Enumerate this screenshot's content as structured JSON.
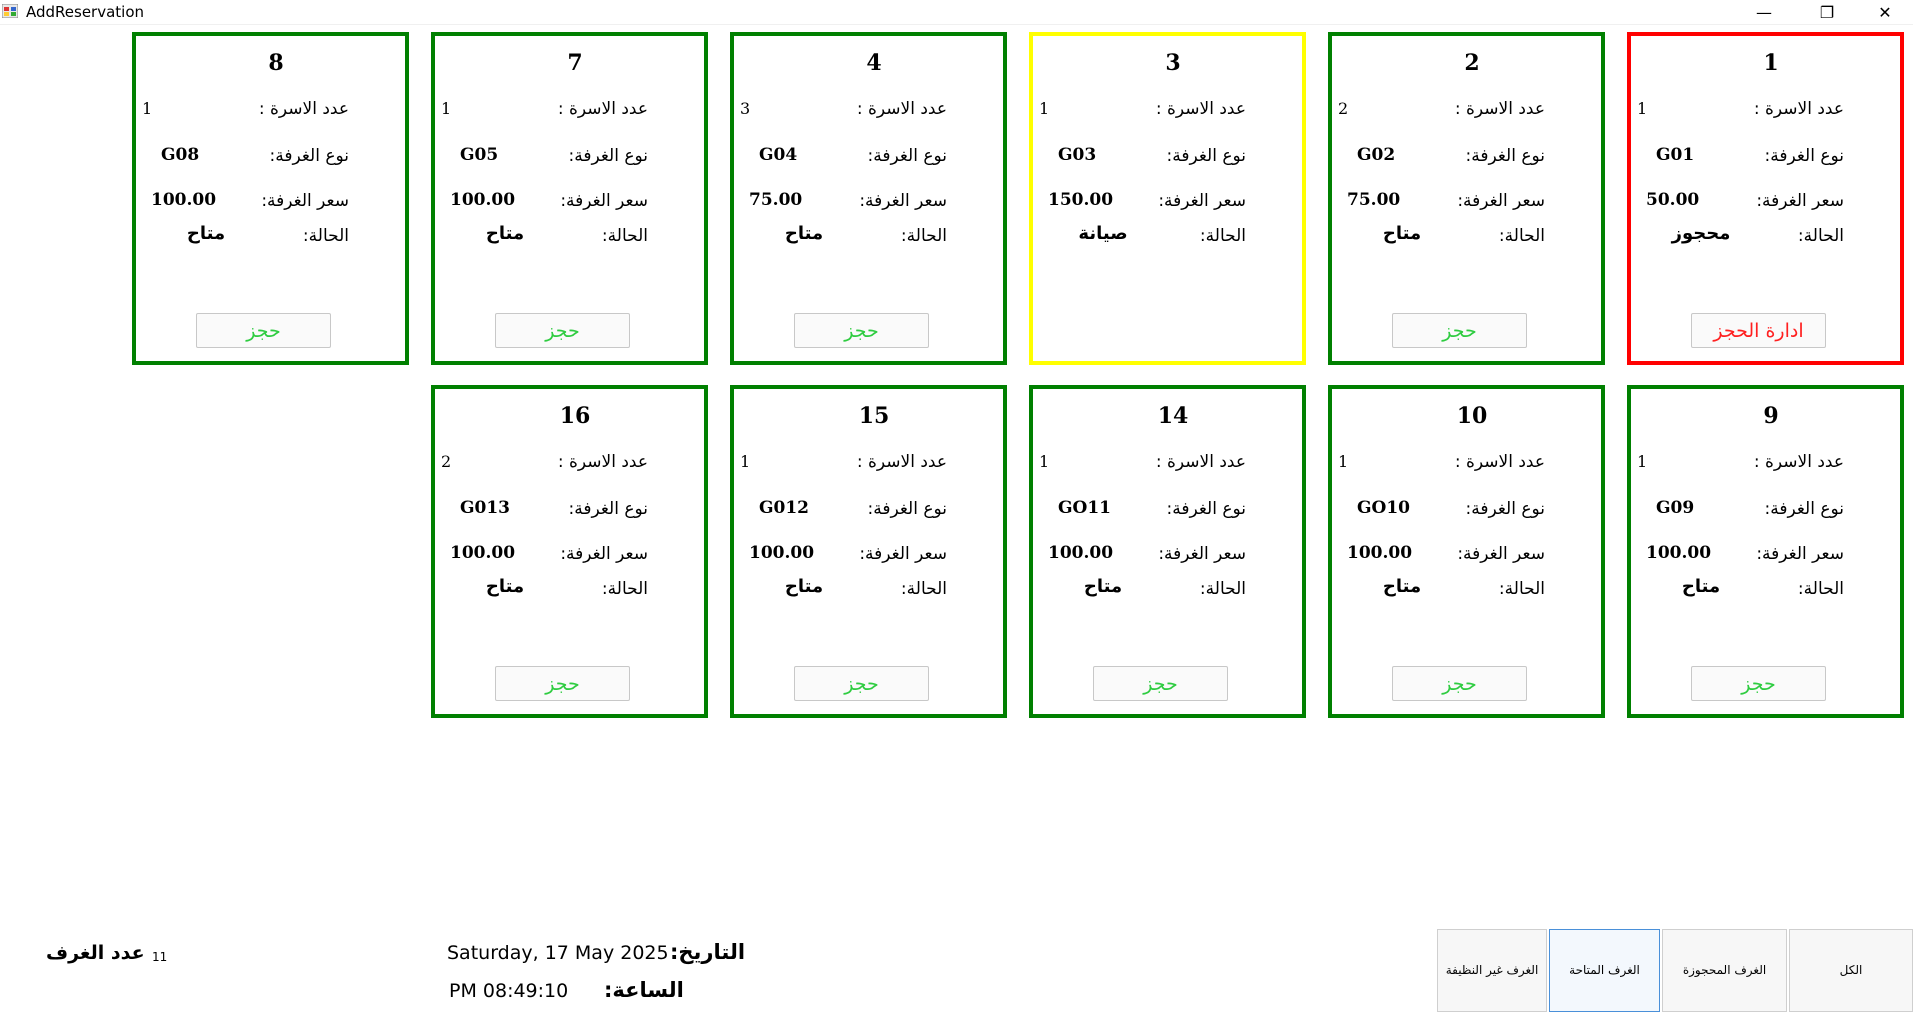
{
  "window": {
    "title": "AddReservation",
    "minimize": "—",
    "maximize": "❐",
    "close": "✕"
  },
  "labels": {
    "beds": "عدد الاسرة :",
    "room_type": "نوع الغرفة:",
    "room_price": "سعر الغرفة:",
    "status": "الحالة:"
  },
  "rooms": [
    {
      "number": "1",
      "beds": "1",
      "type": "G01",
      "price": "50.00",
      "status": "محجوز",
      "state": "booked",
      "action": "ادارة الحجز"
    },
    {
      "number": "2",
      "beds": "2",
      "type": "G02",
      "price": "75.00",
      "status": "متاح",
      "state": "available",
      "action": "حجز"
    },
    {
      "number": "3",
      "beds": "1",
      "type": "G03",
      "price": "150.00",
      "status": "صيانة",
      "state": "maintenance",
      "action": ""
    },
    {
      "number": "4",
      "beds": "3",
      "type": "G04",
      "price": "75.00",
      "status": "متاح",
      "state": "available",
      "action": "حجز"
    },
    {
      "number": "7",
      "beds": "1",
      "type": "G05",
      "price": "100.00",
      "status": "متاح",
      "state": "available",
      "action": "حجز"
    },
    {
      "number": "8",
      "beds": "1",
      "type": "G08",
      "price": "100.00",
      "status": "متاح",
      "state": "available",
      "action": "حجز"
    },
    {
      "number": "9",
      "beds": "1",
      "type": "G09",
      "price": "100.00",
      "status": "متاح",
      "state": "available",
      "action": "حجز"
    },
    {
      "number": "10",
      "beds": "1",
      "type": "GO10",
      "price": "100.00",
      "status": "متاح",
      "state": "available",
      "action": "حجز"
    },
    {
      "number": "14",
      "beds": "1",
      "type": "GO11",
      "price": "100.00",
      "status": "متاح",
      "state": "available",
      "action": "حجز"
    },
    {
      "number": "15",
      "beds": "1",
      "type": "G012",
      "price": "100.00",
      "status": "متاح",
      "state": "available",
      "action": "حجز"
    },
    {
      "number": "16",
      "beds": "2",
      "type": "G013",
      "price": "100.00",
      "status": "متاح",
      "state": "available",
      "action": "حجز"
    }
  ],
  "footer": {
    "rooms_count_label": "عدد الغرف",
    "rooms_count_value": "11",
    "date_label": "التاريخ:",
    "date_value": "Saturday, 17 May 2025",
    "time_label": "الساعة:",
    "time_value": "PM 08:49:10"
  },
  "filters": {
    "all": "الكل",
    "booked": "الغرف المحجوزة",
    "available": "الغرف المتاحة",
    "unclean": "الغرف غير النظيفة"
  },
  "colors": {
    "available": "#008000",
    "booked": "#ff0000",
    "maintenance": "#ffff00",
    "button_text_available": "#2ecc40",
    "button_text_booked": "#ff2020"
  }
}
